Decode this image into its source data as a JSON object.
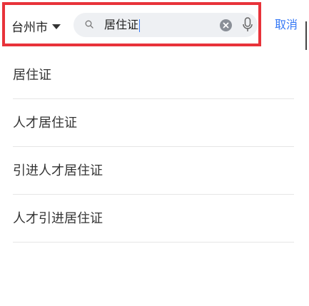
{
  "header": {
    "city": "台州市",
    "search_value": "居住证",
    "cancel_label": "取消",
    "icons": {
      "city_dropdown": "caret-down-icon",
      "search": "search-icon",
      "clear": "clear-icon",
      "voice": "microphone-icon"
    },
    "accent_color": "#3478f6",
    "highlight_color": "#e8333a"
  },
  "suggestions": [
    {
      "label": "居住证"
    },
    {
      "label": "人才居住证"
    },
    {
      "label": "引进人才居住证"
    },
    {
      "label": "人才引进居住证"
    }
  ]
}
